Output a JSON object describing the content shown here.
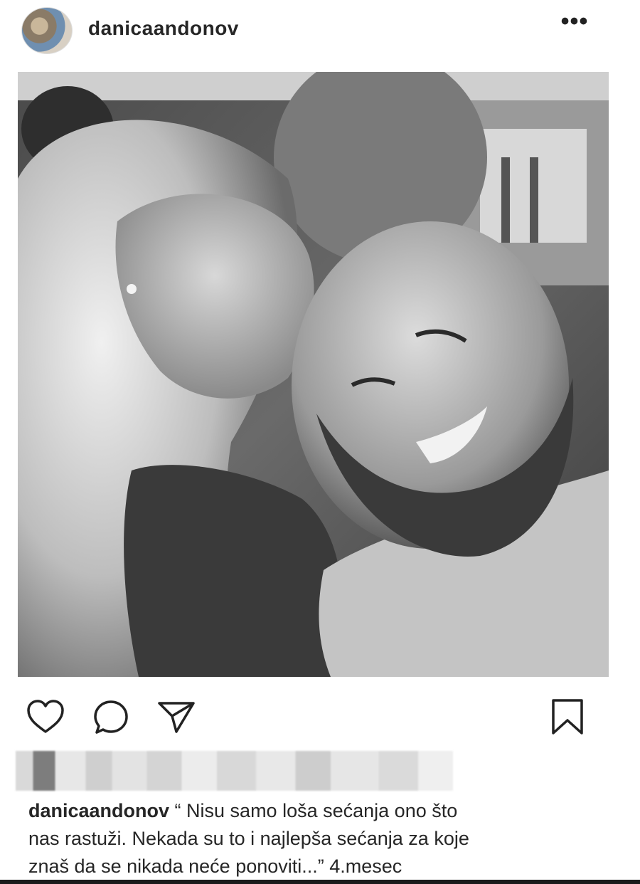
{
  "post": {
    "username": "danicaandonov",
    "more_label": "•••",
    "caption_user": "danicaandonov",
    "caption_lines": [
      "“ Nisu samo loša sećanja ono što",
      "nas rastuži. Nekada su to i najlepša sećanja za koje",
      "znaš da se nikada neće ponoviti...” 4.mesec"
    ]
  },
  "actions": {
    "like_icon": "heart-icon",
    "comment_icon": "comment-icon",
    "share_icon": "send-icon",
    "save_icon": "bookmark-icon"
  },
  "colors": {
    "text": "#262626",
    "photo_tone": "grayscale"
  }
}
